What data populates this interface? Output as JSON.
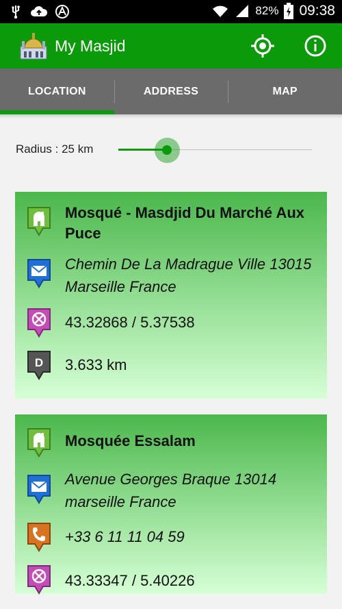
{
  "status_bar": {
    "battery_percent": "82%",
    "time": "09:38",
    "icons": [
      "usb-icon",
      "cloud-upload-icon",
      "logo-icon",
      "wifi-icon",
      "signal-icon",
      "battery-charging-icon"
    ]
  },
  "app_bar": {
    "title": "My Masjid",
    "logo": "mosque-logo",
    "actions": [
      "my-location-icon",
      "info-icon"
    ]
  },
  "tabs": [
    {
      "label": "LOCATION",
      "active": true
    },
    {
      "label": "ADDRESS",
      "active": false
    },
    {
      "label": "MAP",
      "active": false
    }
  ],
  "radius": {
    "label": "Radius : 25 km",
    "slider_fraction": 0.25
  },
  "results": [
    {
      "name": "Mosqué - Masdjid Du Marché Aux Puce",
      "address": "Chemin De La Madrague Ville 13015 Marseille France",
      "coordinates": "43.32868 / 5.37538",
      "distance": "3.633 km"
    },
    {
      "name": "Mosquée Essalam",
      "address": "Avenue Georges Braque 13014 marseille France",
      "phone": "+33 6 11 11 04 59",
      "coordinates": "43.33347 / 5.40226"
    }
  ],
  "colors": {
    "primary_green": "#0a9a0a",
    "tab_bar_gray": "#6b6b6b",
    "mosque_pin": "#6fbf3f",
    "address_pin": "#1f6fd6",
    "coords_pin": "#c44cb8",
    "distance_pin": "#555555",
    "phone_pin": "#d8741f"
  },
  "pin_icons": {
    "mosque": "mosque-pin-icon",
    "address": "envelope-pin-icon",
    "coordinates": "crosshair-pin-icon",
    "distance": "distance-pin-icon",
    "phone": "phone-pin-icon",
    "distance_letter": "D"
  }
}
